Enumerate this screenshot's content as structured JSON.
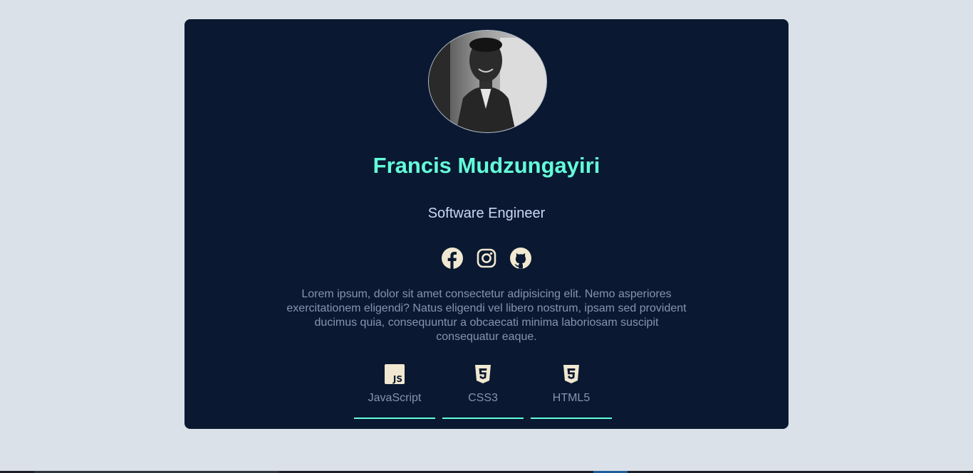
{
  "profile": {
    "name": "Francis Mudzungayiri",
    "role": "Software Engineer",
    "bio": "Lorem ipsum, dolor sit amet consectetur adipisicing elit. Nemo asperiores exercitationem eligendi? Natus eligendi vel libero nostrum, ipsam sed provident ducimus quia, consequuntur a obcaecati minima laboriosam suscipit consequatur eaque."
  },
  "socials": [
    {
      "icon": "facebook-icon"
    },
    {
      "icon": "instagram-icon"
    },
    {
      "icon": "github-icon"
    }
  ],
  "skills": [
    {
      "label": "JavaScript",
      "icon": "javascript-icon"
    },
    {
      "label": "CSS3",
      "icon": "css3-icon"
    },
    {
      "label": "HTML5",
      "icon": "html5-icon"
    }
  ],
  "colors": {
    "background": "#dae1e8",
    "card": "#0a1931",
    "accent": "#64ffda",
    "heading": "#ccd6f6",
    "text": "#8892b0",
    "icon": "#f0e8d0"
  }
}
